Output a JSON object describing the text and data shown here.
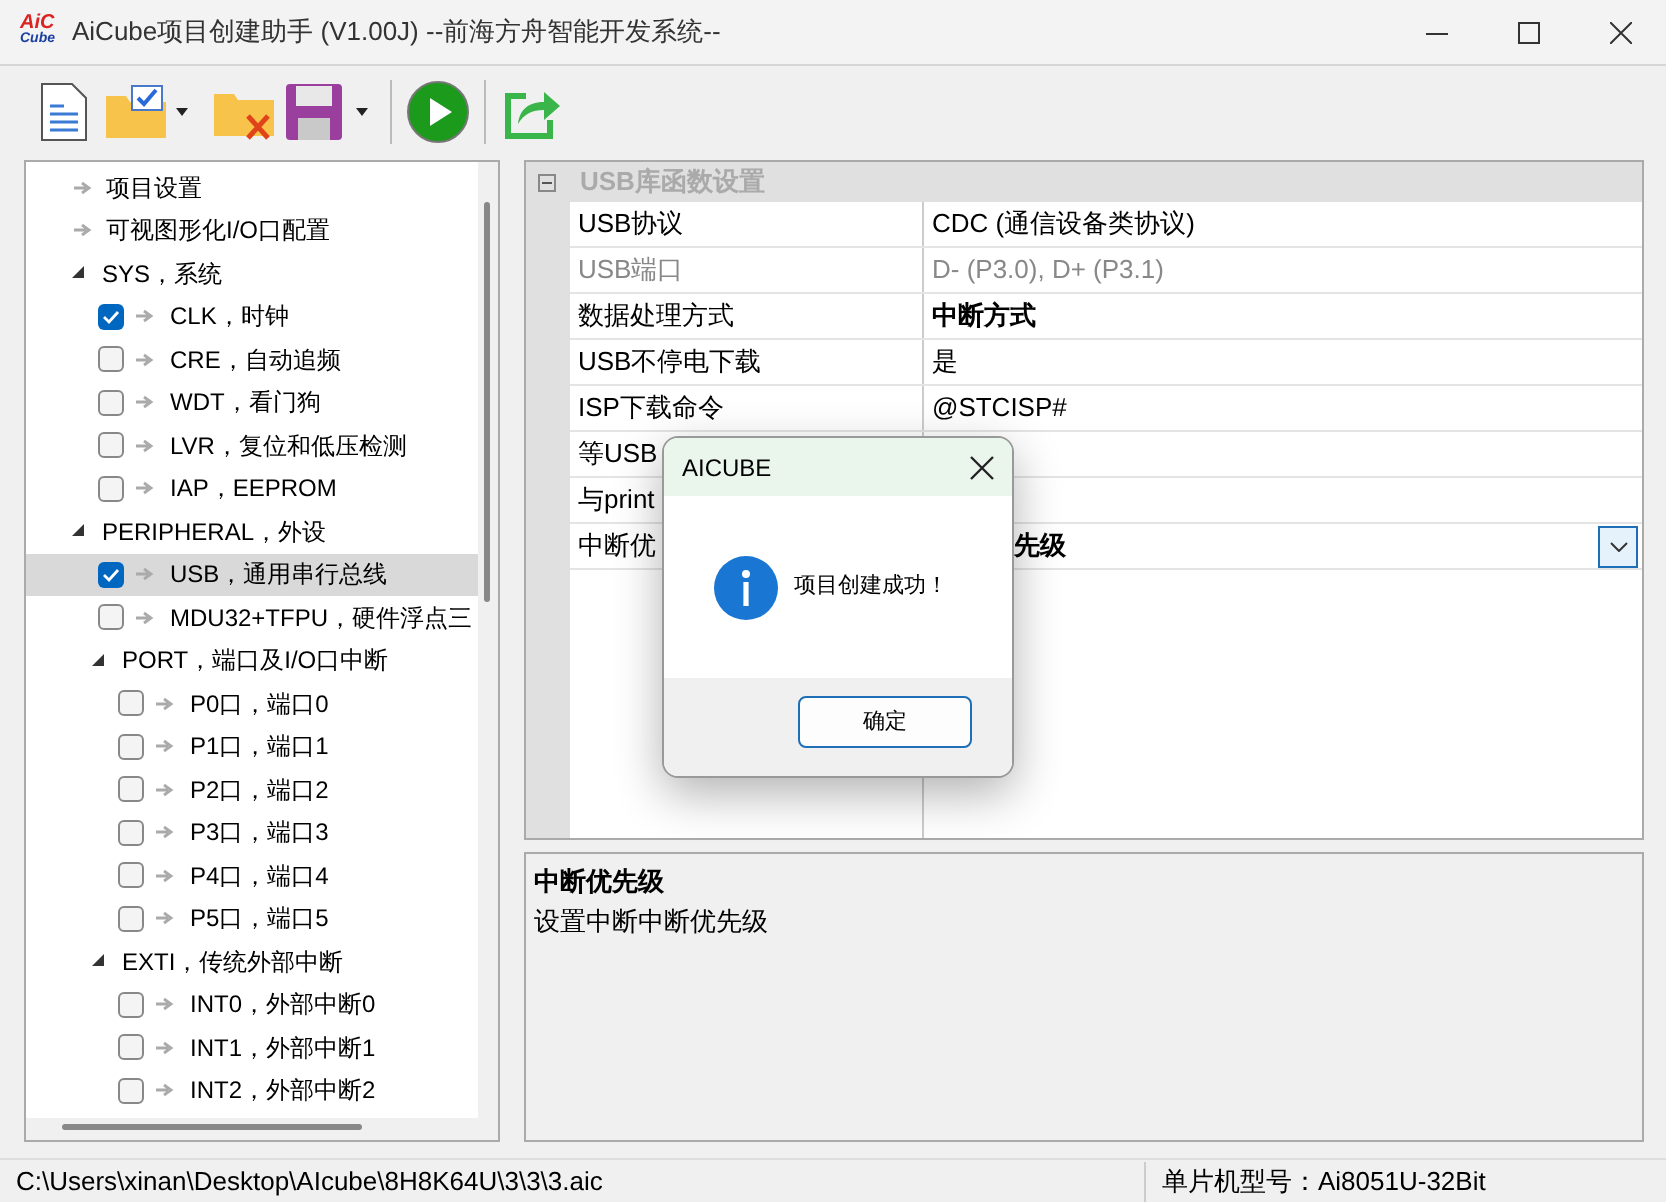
{
  "window": {
    "title": "AiCube项目创建助手 (V1.00J) --前海方舟智能开发系统--",
    "logo": [
      "AiC",
      "Cube"
    ]
  },
  "tree": [
    {
      "label": "项目设置",
      "kind": "link",
      "selected": false
    },
    {
      "label": "可视图形化I/O口配置",
      "kind": "link",
      "selected": false
    },
    {
      "label": "SYS，系统",
      "kind": "group",
      "expanded": true,
      "selected": false,
      "children": [
        {
          "label": "CLK，时钟",
          "kind": "check",
          "checked": true,
          "selected": false
        },
        {
          "label": "CRE，自动追频",
          "kind": "check",
          "checked": false,
          "selected": false
        },
        {
          "label": "WDT，看门狗",
          "kind": "check",
          "checked": false,
          "selected": false
        },
        {
          "label": "LVR，复位和低压检测",
          "kind": "check",
          "checked": false,
          "selected": false
        },
        {
          "label": "IAP，EEPROM",
          "kind": "check",
          "checked": false,
          "selected": false
        }
      ]
    },
    {
      "label": "PERIPHERAL，外设",
      "kind": "group",
      "expanded": true,
      "selected": false,
      "children": [
        {
          "label": "USB，通用串行总线",
          "kind": "check",
          "checked": true,
          "selected": true
        },
        {
          "label": "MDU32+TFPU，硬件浮点三",
          "kind": "check",
          "checked": false,
          "selected": false
        },
        {
          "label": "PORT，端口及I/O口中断",
          "kind": "group",
          "expanded": true,
          "selected": false,
          "children": [
            {
              "label": "P0口，端口0",
              "kind": "check",
              "checked": false,
              "selected": false
            },
            {
              "label": "P1口，端口1",
              "kind": "check",
              "checked": false,
              "selected": false
            },
            {
              "label": "P2口，端口2",
              "kind": "check",
              "checked": false,
              "selected": false
            },
            {
              "label": "P3口，端口3",
              "kind": "check",
              "checked": false,
              "selected": false
            },
            {
              "label": "P4口，端口4",
              "kind": "check",
              "checked": false,
              "selected": false
            },
            {
              "label": "P5口，端口5",
              "kind": "check",
              "checked": false,
              "selected": false
            }
          ]
        },
        {
          "label": "EXTI，传统外部中断",
          "kind": "group",
          "expanded": true,
          "selected": false,
          "children": [
            {
              "label": "INT0，外部中断0",
              "kind": "check",
              "checked": false,
              "selected": false
            },
            {
              "label": "INT1，外部中断1",
              "kind": "check",
              "checked": false,
              "selected": false
            },
            {
              "label": "INT2，外部中断2",
              "kind": "check",
              "checked": false,
              "selected": false
            }
          ]
        }
      ]
    }
  ],
  "property_grid": {
    "category": "USB库函数设置",
    "expanded": true,
    "rows": [
      {
        "label": "USB协议",
        "value": "CDC (通信设备类协议)",
        "disabled": false,
        "modified": false,
        "selected": false
      },
      {
        "label": "USB端口",
        "value": "D- (P3.0), D+ (P3.1)",
        "disabled": true,
        "modified": false,
        "selected": false
      },
      {
        "label": "数据处理方式",
        "value": "中断方式",
        "disabled": false,
        "modified": true,
        "selected": false
      },
      {
        "label": "USB不停电下载",
        "value": "是",
        "disabled": false,
        "modified": false,
        "selected": false
      },
      {
        "label": "ISP下载命令",
        "value": "@STCISP#",
        "disabled": false,
        "modified": false,
        "selected": false
      },
      {
        "label": "等USB",
        "disabled": false,
        "selected": false
      },
      {
        "label": "与print",
        "disabled": false,
        "selected": false
      },
      {
        "label": "中断优",
        "value": "先级",
        "disabled": false,
        "modified": true,
        "selected": true
      }
    ]
  },
  "description": {
    "title": "中断优先级",
    "text": "设置中断中断优先级"
  },
  "dialog": {
    "title": "AICUBE",
    "message": "项目创建成功！",
    "button": "确定"
  },
  "status_bar": {
    "path": "C:\\Users\\xinan\\Desktop\\AIcube\\8H8K64U\\3\\3\\3.aic",
    "chip": "单片机型号：Ai8051U-32Bit"
  }
}
